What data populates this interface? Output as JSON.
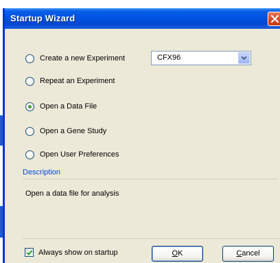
{
  "window": {
    "title": "Startup Wizard"
  },
  "options": [
    {
      "label": "Create a new Experiment",
      "checked": false
    },
    {
      "label": "Repeat an Experiment",
      "checked": false
    },
    {
      "label": "Open a Data File",
      "checked": true
    },
    {
      "label": "Open a Gene Study",
      "checked": false
    },
    {
      "label": "Open User Preferences",
      "checked": false
    }
  ],
  "instrument_select": {
    "value": "CFX96"
  },
  "description": {
    "label": "Description",
    "text": "Open a data file for analysis"
  },
  "footer": {
    "always_show_label": "Always show on startup",
    "always_show_checked": true,
    "ok_label": "OK",
    "cancel_label": "Cancel"
  },
  "colors": {
    "title_bar": "#0055e5",
    "close_button": "#d5512d",
    "description_label": "#0046d5",
    "radio_checked": "#4a9c3a"
  }
}
